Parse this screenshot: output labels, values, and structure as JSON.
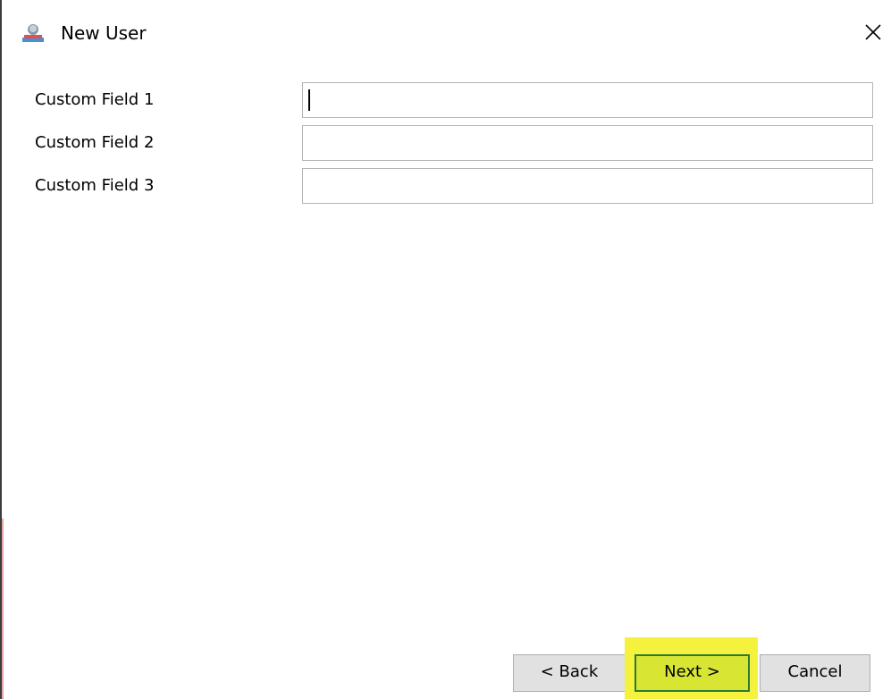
{
  "window": {
    "title": "New User",
    "icon": "user-icon",
    "close_icon": "close-icon"
  },
  "form": {
    "fields": [
      {
        "label": "Custom Field 1",
        "value": "",
        "focused": true
      },
      {
        "label": "Custom Field 2",
        "value": ""
      },
      {
        "label": "Custom Field 3",
        "value": ""
      }
    ]
  },
  "footer": {
    "back_label": "< Back",
    "next_label": "Next >",
    "cancel_label": "Cancel",
    "highlight_color": "#f4f23c",
    "next_border_color": "#2b7a34"
  }
}
